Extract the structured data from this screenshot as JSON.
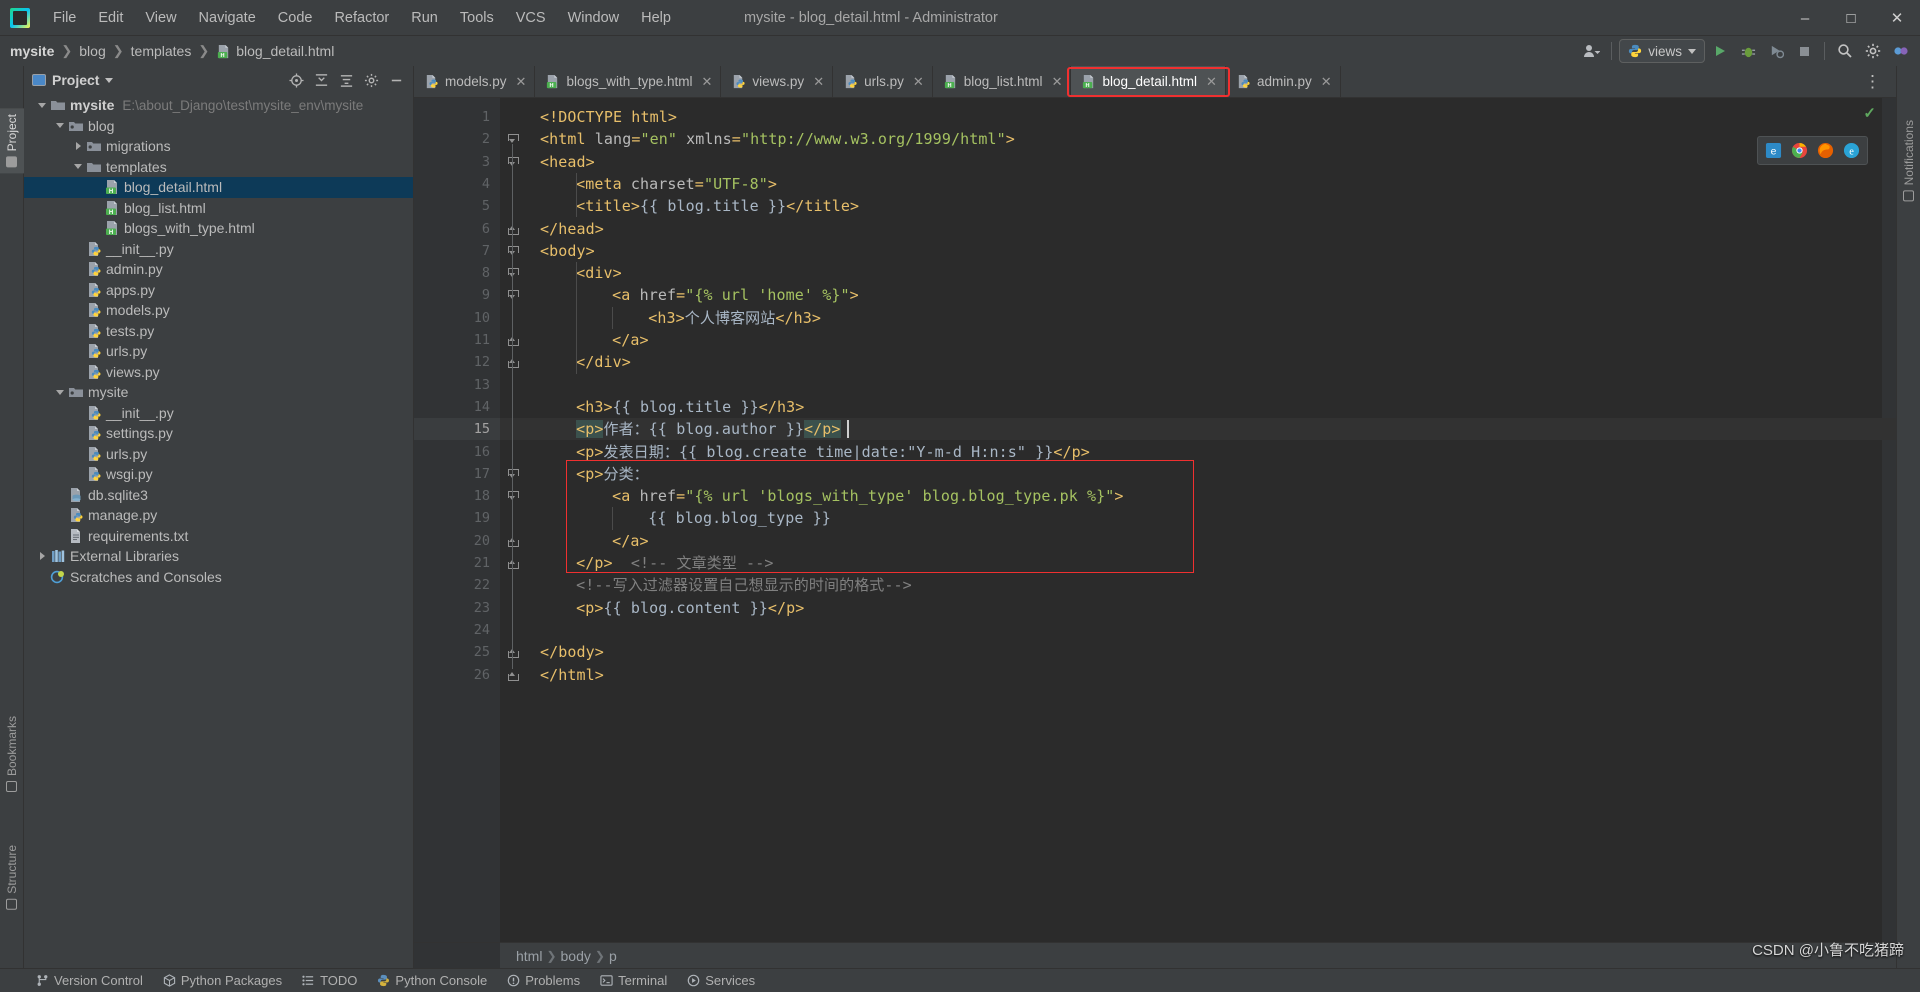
{
  "window": {
    "title": "mysite - blog_detail.html - Administrator",
    "logo_icon": "pycharm-logo-icon",
    "minimize_icon": "minimize-icon",
    "maximize_icon": "maximize-icon",
    "close_icon": "close-icon"
  },
  "menubar": {
    "items": [
      "File",
      "Edit",
      "View",
      "Navigate",
      "Code",
      "Refactor",
      "Run",
      "Tools",
      "VCS",
      "Window",
      "Help"
    ]
  },
  "navbar": {
    "crumbs": [
      "mysite",
      "blog",
      "templates",
      "blog_detail.html"
    ],
    "run_config": "views",
    "buttons": {
      "account": "account-icon",
      "run": "run-icon",
      "debug": "debug-icon",
      "coverage": "coverage-icon",
      "stop": "stop-icon",
      "search": "search-icon",
      "settings": "gear-icon",
      "updates": "updates-icon"
    }
  },
  "left_strip": {
    "tabs": [
      {
        "label": "Project",
        "active": true
      },
      {
        "label": "Bookmarks",
        "active": false
      },
      {
        "label": "Structure",
        "active": false
      }
    ]
  },
  "right_strip": {
    "tabs": [
      {
        "label": "Notifications",
        "active": false
      }
    ]
  },
  "project_panel": {
    "title": "Project",
    "toolbar_icons": [
      "target-icon",
      "collapse-all-icon",
      "expand-all-icon",
      "gear-icon",
      "hide-icon"
    ],
    "tree": [
      {
        "depth": 0,
        "label": "mysite",
        "path": "E:\\about_Django\\test\\mysite_env\\mysite",
        "icon": "folder-icon",
        "arrow": "open",
        "bold": true,
        "selected": false
      },
      {
        "depth": 1,
        "label": "blog",
        "path": "",
        "icon": "source-folder-icon",
        "arrow": "open",
        "bold": false,
        "selected": false
      },
      {
        "depth": 2,
        "label": "migrations",
        "path": "",
        "icon": "source-folder-icon",
        "arrow": "closed",
        "bold": false,
        "selected": false
      },
      {
        "depth": 2,
        "label": "templates",
        "path": "",
        "icon": "folder-icon",
        "arrow": "open",
        "bold": false,
        "selected": false
      },
      {
        "depth": 3,
        "label": "blog_detail.html",
        "path": "",
        "icon": "html-file-icon",
        "arrow": "none",
        "bold": false,
        "selected": true
      },
      {
        "depth": 3,
        "label": "blog_list.html",
        "path": "",
        "icon": "html-file-icon",
        "arrow": "none",
        "bold": false,
        "selected": false
      },
      {
        "depth": 3,
        "label": "blogs_with_type.html",
        "path": "",
        "icon": "html-file-icon",
        "arrow": "none",
        "bold": false,
        "selected": false
      },
      {
        "depth": 2,
        "label": "__init__.py",
        "path": "",
        "icon": "python-file-icon",
        "arrow": "none",
        "bold": false,
        "selected": false
      },
      {
        "depth": 2,
        "label": "admin.py",
        "path": "",
        "icon": "python-file-icon",
        "arrow": "none",
        "bold": false,
        "selected": false
      },
      {
        "depth": 2,
        "label": "apps.py",
        "path": "",
        "icon": "python-file-icon",
        "arrow": "none",
        "bold": false,
        "selected": false
      },
      {
        "depth": 2,
        "label": "models.py",
        "path": "",
        "icon": "python-file-icon",
        "arrow": "none",
        "bold": false,
        "selected": false
      },
      {
        "depth": 2,
        "label": "tests.py",
        "path": "",
        "icon": "python-file-icon",
        "arrow": "none",
        "bold": false,
        "selected": false
      },
      {
        "depth": 2,
        "label": "urls.py",
        "path": "",
        "icon": "python-file-icon",
        "arrow": "none",
        "bold": false,
        "selected": false
      },
      {
        "depth": 2,
        "label": "views.py",
        "path": "",
        "icon": "python-file-icon",
        "arrow": "none",
        "bold": false,
        "selected": false
      },
      {
        "depth": 1,
        "label": "mysite",
        "path": "",
        "icon": "source-folder-icon",
        "arrow": "open",
        "bold": false,
        "selected": false
      },
      {
        "depth": 2,
        "label": "__init__.py",
        "path": "",
        "icon": "python-file-icon",
        "arrow": "none",
        "bold": false,
        "selected": false
      },
      {
        "depth": 2,
        "label": "settings.py",
        "path": "",
        "icon": "python-file-icon",
        "arrow": "none",
        "bold": false,
        "selected": false
      },
      {
        "depth": 2,
        "label": "urls.py",
        "path": "",
        "icon": "python-file-icon",
        "arrow": "none",
        "bold": false,
        "selected": false
      },
      {
        "depth": 2,
        "label": "wsgi.py",
        "path": "",
        "icon": "python-file-icon",
        "arrow": "none",
        "bold": false,
        "selected": false
      },
      {
        "depth": 1,
        "label": "db.sqlite3",
        "path": "",
        "icon": "database-file-icon",
        "arrow": "none",
        "bold": false,
        "selected": false
      },
      {
        "depth": 1,
        "label": "manage.py",
        "path": "",
        "icon": "python-file-icon",
        "arrow": "none",
        "bold": false,
        "selected": false
      },
      {
        "depth": 1,
        "label": "requirements.txt",
        "path": "",
        "icon": "text-file-icon",
        "arrow": "none",
        "bold": false,
        "selected": false
      },
      {
        "depth": 0,
        "label": "External Libraries",
        "path": "",
        "icon": "library-icon",
        "arrow": "closed",
        "bold": false,
        "selected": false
      },
      {
        "depth": 0,
        "label": "Scratches and Consoles",
        "path": "",
        "icon": "scratches-icon",
        "arrow": "none",
        "bold": false,
        "selected": false
      }
    ]
  },
  "editor": {
    "tabs": [
      {
        "label": "models.py",
        "icon": "python-file-icon",
        "active": false,
        "highlighted": false
      },
      {
        "label": "blogs_with_type.html",
        "icon": "html-file-icon",
        "active": false,
        "highlighted": false
      },
      {
        "label": "views.py",
        "icon": "python-file-icon",
        "active": false,
        "highlighted": false
      },
      {
        "label": "urls.py",
        "icon": "python-file-icon",
        "active": false,
        "highlighted": false
      },
      {
        "label": "blog_list.html",
        "icon": "html-file-icon",
        "active": false,
        "highlighted": false
      },
      {
        "label": "blog_detail.html",
        "icon": "html-file-icon",
        "active": true,
        "highlighted": true
      },
      {
        "label": "admin.py",
        "icon": "python-file-icon",
        "active": false,
        "highlighted": false
      }
    ],
    "current_line": 15,
    "total_lines": 26,
    "lines": [
      {
        "n": 1,
        "indent": 0,
        "fold": "none",
        "tokens": [
          {
            "t": "tag",
            "v": "<!DOCTYPE html>"
          }
        ]
      },
      {
        "n": 2,
        "indent": 0,
        "fold": "open",
        "tokens": [
          {
            "t": "tag",
            "v": "<html "
          },
          {
            "t": "attr",
            "v": "lang"
          },
          {
            "t": "tag",
            "v": "="
          },
          {
            "t": "str",
            "v": "\"en\""
          },
          {
            "t": "tag",
            "v": " "
          },
          {
            "t": "attr",
            "v": "xmlns"
          },
          {
            "t": "tag",
            "v": "="
          },
          {
            "t": "str",
            "v": "\"http://www.w3.org/1999/html\""
          },
          {
            "t": "tag",
            "v": ">"
          }
        ]
      },
      {
        "n": 3,
        "indent": 0,
        "fold": "open",
        "tokens": [
          {
            "t": "tag",
            "v": "<head>"
          }
        ]
      },
      {
        "n": 4,
        "indent": 1,
        "fold": "none",
        "tokens": [
          {
            "t": "tag",
            "v": "<meta "
          },
          {
            "t": "attr",
            "v": "charset"
          },
          {
            "t": "tag",
            "v": "="
          },
          {
            "t": "str",
            "v": "\"UTF-8\""
          },
          {
            "t": "tag",
            "v": ">"
          }
        ]
      },
      {
        "n": 5,
        "indent": 1,
        "fold": "none",
        "tokens": [
          {
            "t": "tag",
            "v": "<title>"
          },
          {
            "t": "txt",
            "v": "{{ blog.title }}"
          },
          {
            "t": "tag",
            "v": "</title>"
          }
        ]
      },
      {
        "n": 6,
        "indent": 0,
        "fold": "close",
        "tokens": [
          {
            "t": "tag",
            "v": "</head>"
          }
        ]
      },
      {
        "n": 7,
        "indent": 0,
        "fold": "open",
        "tokens": [
          {
            "t": "tag",
            "v": "<body>"
          }
        ]
      },
      {
        "n": 8,
        "indent": 1,
        "fold": "open",
        "tokens": [
          {
            "t": "tag",
            "v": "<div>"
          }
        ]
      },
      {
        "n": 9,
        "indent": 2,
        "fold": "open",
        "tokens": [
          {
            "t": "tag",
            "v": "<a "
          },
          {
            "t": "attr",
            "v": "href"
          },
          {
            "t": "tag",
            "v": "="
          },
          {
            "t": "str",
            "v": "\"{% url 'home' %}\""
          },
          {
            "t": "tag",
            "v": ">"
          }
        ]
      },
      {
        "n": 10,
        "indent": 3,
        "fold": "none",
        "tokens": [
          {
            "t": "tag",
            "v": "<h3>"
          },
          {
            "t": "txt",
            "v": "个人博客网站"
          },
          {
            "t": "tag",
            "v": "</h3>"
          }
        ]
      },
      {
        "n": 11,
        "indent": 2,
        "fold": "close",
        "tokens": [
          {
            "t": "tag",
            "v": "</a>"
          }
        ]
      },
      {
        "n": 12,
        "indent": 1,
        "fold": "close",
        "tokens": [
          {
            "t": "tag",
            "v": "</div>"
          }
        ]
      },
      {
        "n": 13,
        "indent": 0,
        "fold": "none",
        "tokens": []
      },
      {
        "n": 14,
        "indent": 1,
        "fold": "none",
        "tokens": [
          {
            "t": "tag",
            "v": "<h3>"
          },
          {
            "t": "txt",
            "v": "{{ blog.title }}"
          },
          {
            "t": "tag",
            "v": "</h3>"
          }
        ]
      },
      {
        "n": 15,
        "indent": 1,
        "fold": "none",
        "tokens": [
          {
            "t": "tag-hl",
            "v": "<p>"
          },
          {
            "t": "txt",
            "v": "作者："
          },
          {
            "t": "txt",
            "v": "{{ blog.author }}"
          },
          {
            "t": "tag-hl",
            "v": "</p>"
          }
        ]
      },
      {
        "n": 16,
        "indent": 1,
        "fold": "none",
        "tokens": [
          {
            "t": "tag",
            "v": "<p>"
          },
          {
            "t": "txt",
            "v": "发表日期："
          },
          {
            "t": "txt",
            "v": "{{ blog.create_time|date:\"Y-m-d H:n:s\" }}"
          },
          {
            "t": "tag",
            "v": "</p>"
          }
        ]
      },
      {
        "n": 17,
        "indent": 1,
        "fold": "open",
        "tokens": [
          {
            "t": "tag",
            "v": "<p>"
          },
          {
            "t": "txt",
            "v": "分类："
          }
        ]
      },
      {
        "n": 18,
        "indent": 2,
        "fold": "open",
        "tokens": [
          {
            "t": "tag",
            "v": "<a "
          },
          {
            "t": "attr",
            "v": "href"
          },
          {
            "t": "tag",
            "v": "="
          },
          {
            "t": "str",
            "v": "\"{% url 'blogs_with_type' blog.blog_type.pk %}\""
          },
          {
            "t": "tag",
            "v": ">"
          }
        ]
      },
      {
        "n": 19,
        "indent": 3,
        "fold": "none",
        "tokens": [
          {
            "t": "txt",
            "v": "{{ blog.blog_type }}"
          }
        ]
      },
      {
        "n": 20,
        "indent": 2,
        "fold": "close",
        "tokens": [
          {
            "t": "tag",
            "v": "</a>"
          }
        ]
      },
      {
        "n": 21,
        "indent": 1,
        "fold": "close",
        "tokens": [
          {
            "t": "tag",
            "v": "</p>"
          },
          {
            "t": "plain",
            "v": "  "
          },
          {
            "t": "com",
            "v": "<!-- 文章类型 -->"
          }
        ]
      },
      {
        "n": 22,
        "indent": 1,
        "fold": "none",
        "tokens": [
          {
            "t": "com",
            "v": "<!--写入过滤器设置自己想显示的时间的格式-->"
          }
        ]
      },
      {
        "n": 23,
        "indent": 1,
        "fold": "none",
        "tokens": [
          {
            "t": "tag",
            "v": "<p>"
          },
          {
            "t": "txt",
            "v": "{{ blog.content }}"
          },
          {
            "t": "tag",
            "v": "</p>"
          }
        ]
      },
      {
        "n": 24,
        "indent": 0,
        "fold": "none",
        "tokens": []
      },
      {
        "n": 25,
        "indent": 0,
        "fold": "close",
        "tokens": [
          {
            "t": "tag",
            "v": "</body>"
          }
        ]
      },
      {
        "n": 26,
        "indent": 0,
        "fold": "close",
        "tokens": [
          {
            "t": "tag",
            "v": "</html>"
          }
        ]
      }
    ],
    "float_icons": [
      "browser-edge-icon",
      "browser-chrome-icon",
      "browser-firefox-icon",
      "browser-ie-icon"
    ],
    "inspection_status": "ok-check-icon"
  },
  "bottom_breadcrumbs": [
    "html",
    "body",
    "p"
  ],
  "statusbar": {
    "items": [
      {
        "label": "Version Control",
        "icon": "branch-icon"
      },
      {
        "label": "Python Packages",
        "icon": "package-icon"
      },
      {
        "label": "TODO",
        "icon": "todo-icon"
      },
      {
        "label": "Python Console",
        "icon": "console-icon"
      },
      {
        "label": "Problems",
        "icon": "problems-icon"
      },
      {
        "label": "Terminal",
        "icon": "terminal-icon"
      },
      {
        "label": "Services",
        "icon": "services-icon"
      }
    ]
  },
  "watermark": "CSDN @小鲁不吃猪蹄",
  "colors": {
    "accent_red": "#f03030",
    "tag": "#e8bf6a",
    "string": "#a5c261",
    "text": "#a9b7c6",
    "comment": "#808080",
    "selection": "#0d3a58",
    "editor_bg": "#2b2b2b",
    "panel_bg": "#3c3f41"
  }
}
